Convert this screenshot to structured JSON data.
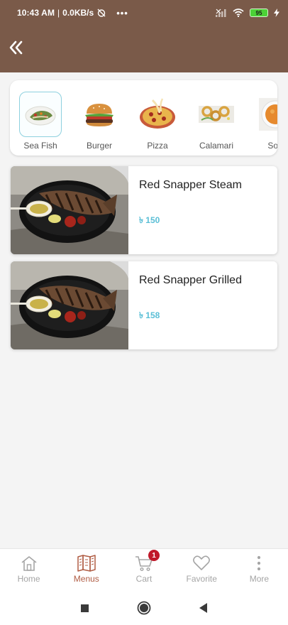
{
  "status": {
    "time": "10:43 AM",
    "separator": "|",
    "speed": "0.0KB/s",
    "dots": "•••",
    "battery": "95"
  },
  "colors": {
    "brand": "#7a5a49",
    "accent_active": "#b05d44",
    "price": "#5bbfd6",
    "badge": "#c0192a"
  },
  "categories": [
    {
      "label": "Sea Fish",
      "icon": "sea-fish-dish-image",
      "selected": true
    },
    {
      "label": "Burger",
      "icon": "burger-image",
      "selected": false
    },
    {
      "label": "Pizza",
      "icon": "pizza-image",
      "selected": false
    },
    {
      "label": "Calamari",
      "icon": "calamari-image",
      "selected": false
    },
    {
      "label": "Sou",
      "icon": "soup-image",
      "selected": false
    }
  ],
  "products": [
    {
      "name": "Red Snapper Steam",
      "price": "৳ 150",
      "image": "grilled-fish-photo"
    },
    {
      "name": "Red Snapper Grilled",
      "price": "৳ 158",
      "image": "grilled-fish-photo"
    }
  ],
  "nav": {
    "items": [
      {
        "label": "Home",
        "icon": "home-icon"
      },
      {
        "label": "Menus",
        "icon": "menu-book-icon",
        "active": true
      },
      {
        "label": "Cart",
        "icon": "cart-icon",
        "badge": "1"
      },
      {
        "label": "Favorite",
        "icon": "heart-icon"
      },
      {
        "label": "More",
        "icon": "more-vertical-icon"
      }
    ]
  }
}
